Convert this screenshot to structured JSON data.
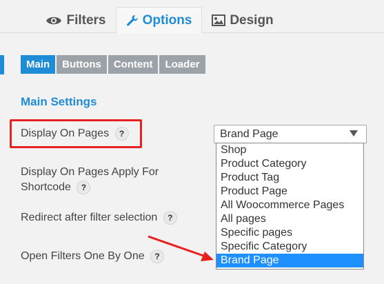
{
  "tabs": [
    {
      "label": "Filters",
      "icon": "eye-icon"
    },
    {
      "label": "Options",
      "icon": "wrench-icon"
    },
    {
      "label": "Design",
      "icon": "image-icon"
    }
  ],
  "active_tab": "Options",
  "sub_tabs": [
    {
      "label": "Main"
    },
    {
      "label": "Buttons"
    },
    {
      "label": "Content"
    },
    {
      "label": "Loader"
    }
  ],
  "active_sub_tab": "Main",
  "section_title": "Main Settings",
  "settings": [
    {
      "label": "Display On Pages"
    },
    {
      "label_line1": "Display On Pages Apply For",
      "label_line2": "Shortcode"
    },
    {
      "label": "Redirect after filter selection"
    },
    {
      "label": "Open Filters One By One"
    }
  ],
  "help_glyph": "?",
  "select": {
    "value": "Brand Page",
    "options": [
      "Shop",
      "Product Category",
      "Product Tag",
      "Product Page",
      "All Woocommerce Pages",
      "All pages",
      "Specific pages",
      "Specific Category",
      "Brand Page"
    ],
    "selected_index": 8
  },
  "annotation_colors": {
    "highlight": "#e8201f",
    "arrow": "#e8201f"
  },
  "colors": {
    "accent": "#1e8cd6",
    "inactive_subtab": "#9ca3a8",
    "option_highlight": "#1e90ff"
  }
}
